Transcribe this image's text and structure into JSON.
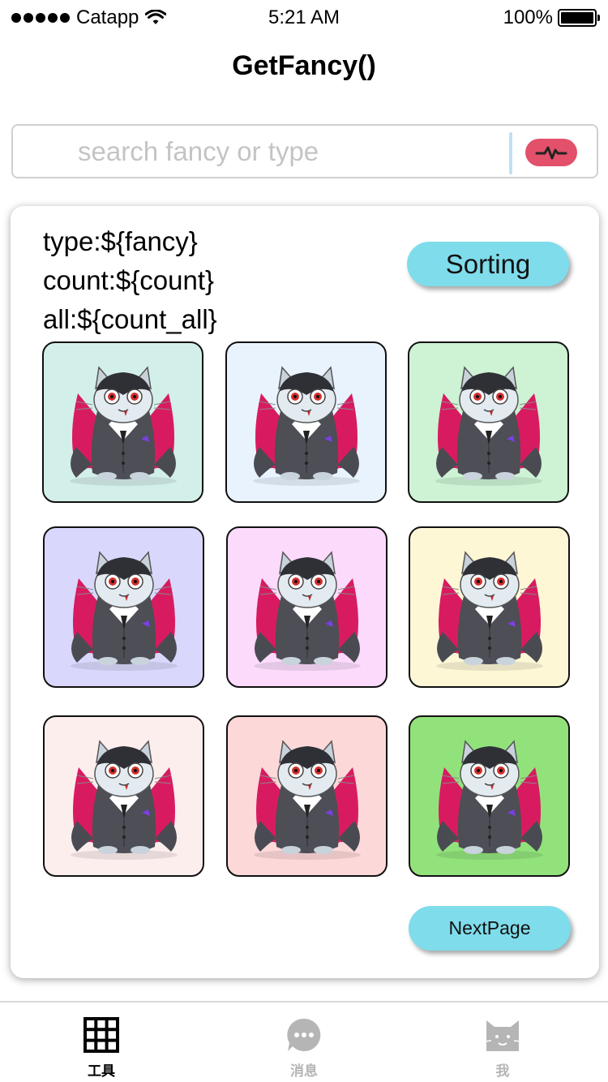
{
  "status_bar": {
    "carrier": "Catapp",
    "time": "5:21 AM",
    "battery_percent": "100%",
    "battery_level": 1.0
  },
  "header": {
    "title": "GetFancy()"
  },
  "search": {
    "placeholder": "search fancy or type",
    "value": "",
    "pulse_color": "#e2506a"
  },
  "info": {
    "type_line": "type:${fancy}",
    "count_line": "count:${count}",
    "all_line": "all:${count_all}"
  },
  "buttons": {
    "sorting": "Sorting",
    "next_page": "NextPage",
    "accent": "#7fdceb"
  },
  "grid": {
    "items": [
      {
        "name": "vampire-cat",
        "bg": "#d3efe9"
      },
      {
        "name": "vampire-cat",
        "bg": "#e9f3fe"
      },
      {
        "name": "vampire-cat",
        "bg": "#cdf2d4"
      },
      {
        "name": "vampire-cat",
        "bg": "#d9d8fc"
      },
      {
        "name": "vampire-cat",
        "bg": "#fbdafc"
      },
      {
        "name": "vampire-cat",
        "bg": "#fdf7d6"
      },
      {
        "name": "vampire-cat",
        "bg": "#fdeeee"
      },
      {
        "name": "vampire-cat",
        "bg": "#fdd8d9"
      },
      {
        "name": "vampire-cat",
        "bg": "#92e27c"
      }
    ]
  },
  "tabbar": {
    "tabs": [
      {
        "label": "工具",
        "icon": "grid-icon",
        "active": true
      },
      {
        "label": "消息",
        "icon": "chat-bubble-icon",
        "active": false
      },
      {
        "label": "我",
        "icon": "cat-face-icon",
        "active": false
      }
    ]
  }
}
